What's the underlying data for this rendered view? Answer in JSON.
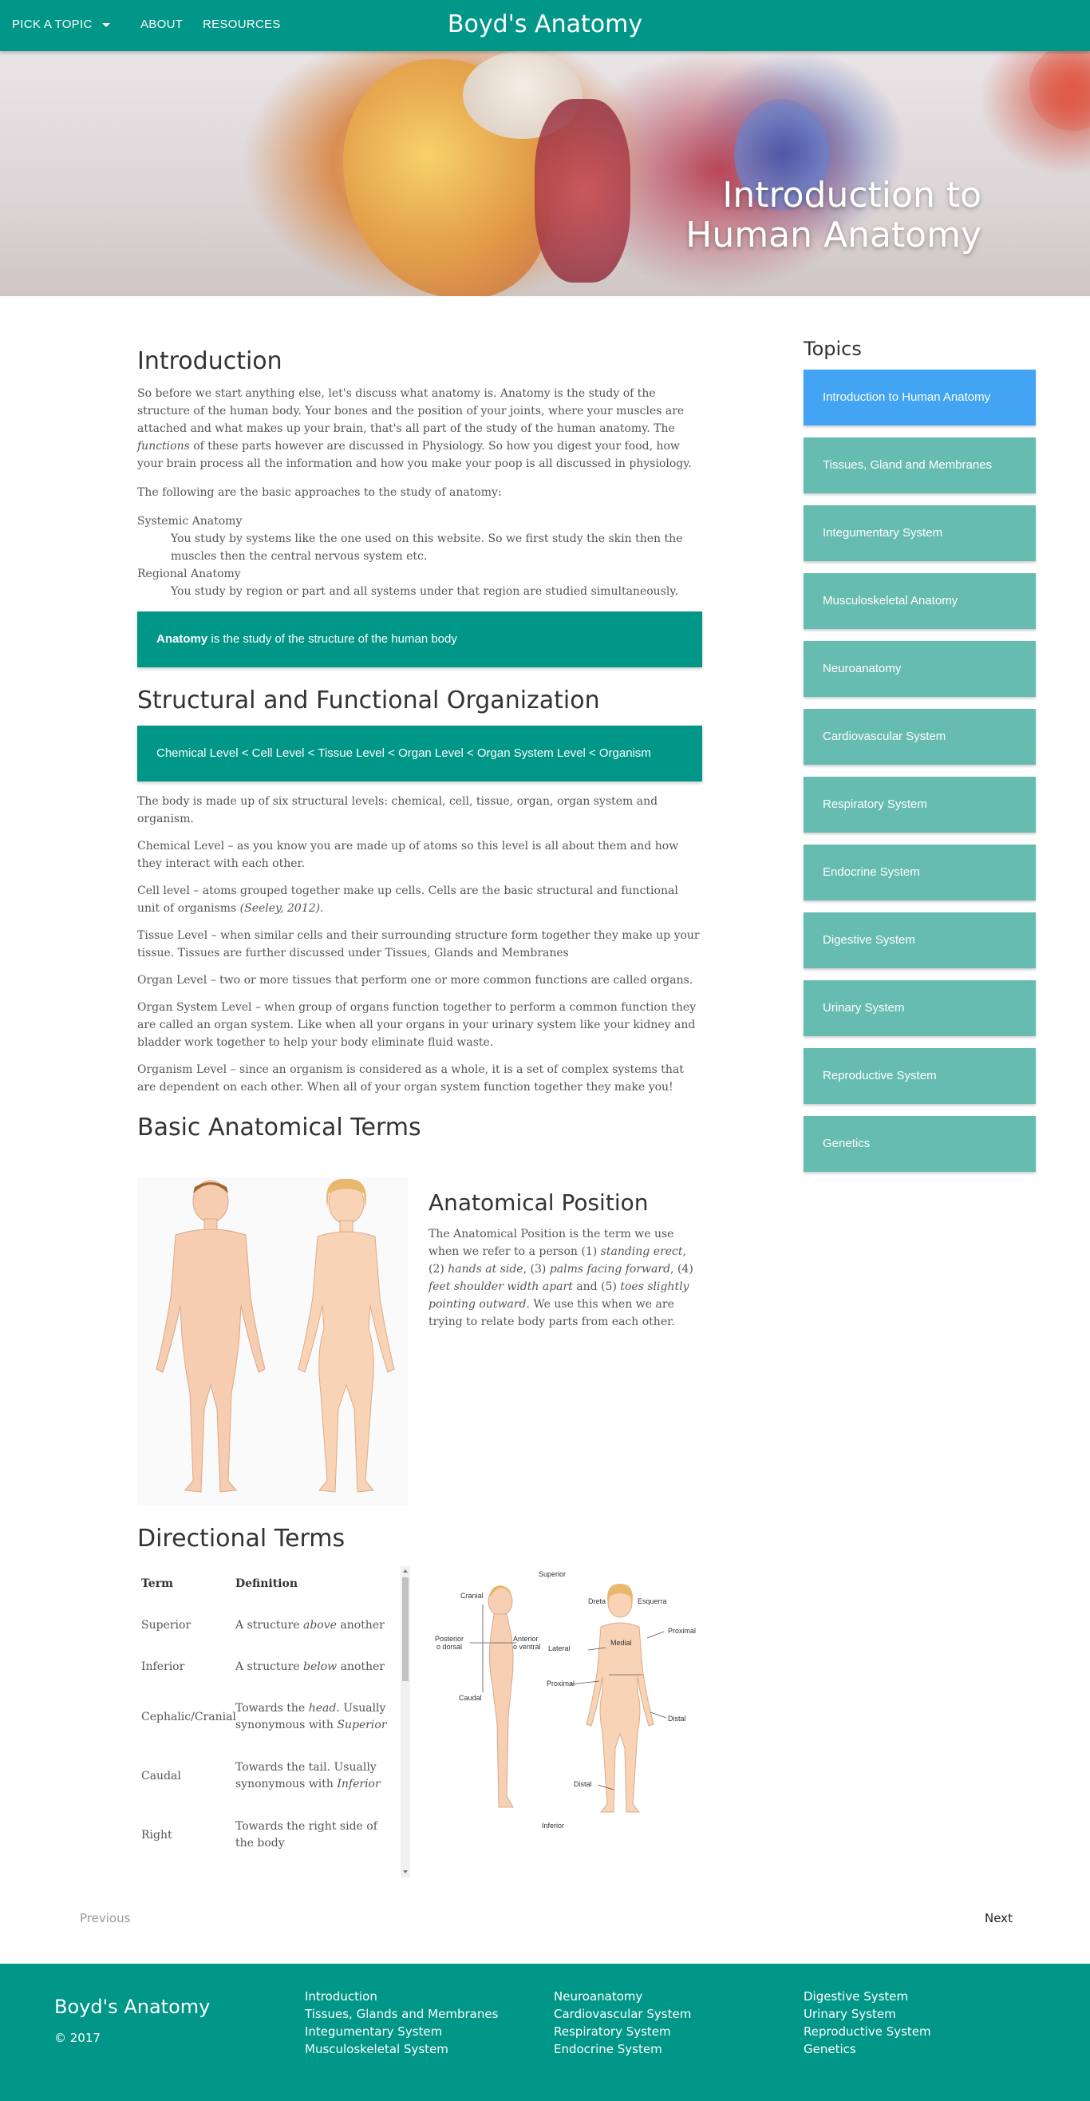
{
  "nav": {
    "pick_topic": "PICK A TOPIC",
    "about": "ABOUT",
    "resources": "RESOURCES",
    "brand": "Boyd's Anatomy"
  },
  "hero": {
    "title_line1": "Introduction to",
    "title_line2": "Human Anatomy"
  },
  "intro": {
    "heading": "Introduction",
    "p1_a": "So before we start anything else, let's discuss what anatomy is. Anatomy is the study of the structure of the human body. Your bones and the position of your joints, where your muscles are attached and what makes up your brain, that's all part of the study of the human anatomy. The ",
    "p1_em": "functions",
    "p1_b": " of these parts however are discussed in Physiology. So how you digest your food, how your brain process all the information and how you make your poop is all discussed in physiology.",
    "p2": "The following are the basic approaches to the study of anatomy:",
    "term1": "Systemic Anatomy",
    "def1": "You study by systems like the one used on this website. So we first study the skin then the muscles then the central nervous system etc.",
    "term2": "Regional Anatomy",
    "def2": "You study by region or part and all systems under that region are studied simultaneously.",
    "callout_strong": "Anatomy",
    "callout_rest": " is the study of the structure of the human body"
  },
  "structural": {
    "heading": "Structural and Functional Organization",
    "callout": "Chemical Level < Cell Level < Tissue Level < Organ Level < Organ System Level < Organism",
    "p1": "The body is made up of six structural levels: chemical, cell, tissue, organ, organ system and organism.",
    "p2": "Chemical Level – as you know you are made up of atoms so this level is all about them and how they interact with each other.",
    "p3_a": "Cell level – atoms grouped together make up cells. Cells are the basic structural and functional unit of organisms ",
    "p3_em": "(Seeley, 2012).",
    "p4": "Tissue Level – when similar cells and their surrounding structure form together they make up your tissue. Tissues are further discussed under Tissues, Glands and Membranes",
    "p5": "Organ Level – two or more tissues that perform one or more common functions are called organs.",
    "p6": "Organ System Level – when group of organs function together to perform a common function they are called an organ system. Like when all your organs in your urinary system like your kidney and bladder work together to help your body eliminate fluid waste.",
    "p7": "Organism Level – since an organism is considered as a whole, it is a set of complex systems that are dependent on each other. When all of your organ system function together they make you!"
  },
  "terms": {
    "heading": "Basic Anatomical Terms",
    "position_heading": "Anatomical Position",
    "pos_a": "The Anatomical Position is the term we use when we refer to a person (1) ",
    "pos_em1": "standing erect",
    "pos_b": ", (2) ",
    "pos_em2": "hands at side",
    "pos_c": ", (3) ",
    "pos_em3": "palms facing forward",
    "pos_d": ", (4) ",
    "pos_em4": "feet shoulder width apart",
    "pos_e": " and (5) ",
    "pos_em5": "toes slightly pointing outward",
    "pos_f": ". We use this when we are trying to relate body parts from each other."
  },
  "directional": {
    "heading": "Directional Terms",
    "col_term": "Term",
    "col_def": "Definition",
    "rows": [
      {
        "term": "Superior",
        "def_a": "A structure ",
        "def_em": "above",
        "def_b": " another"
      },
      {
        "term": "Inferior",
        "def_a": "A structure ",
        "def_em": "below",
        "def_b": " another"
      },
      {
        "term": "Cephalic/Cranial",
        "def_a": "Towards the ",
        "def_em": "head",
        "def_b": ". Usually synonymous with ",
        "def_em2": "Superior"
      },
      {
        "term": "Caudal",
        "def_a": "Towards the tail. Usually synonymous with ",
        "def_em": "Inferior",
        "def_b": ""
      },
      {
        "term": "Right",
        "def_a": "Towards the right side of the body",
        "def_em": "",
        "def_b": ""
      }
    ],
    "figure_labels": {
      "superior": "Superior",
      "cranial": "Cranial",
      "dreta": "Dreta",
      "esquerra": "Esquerra",
      "proximal_r": "Proximal",
      "posterior": "Posterior",
      "dorsal": "o dorsal",
      "anterior": "Anterior",
      "ventral": "o ventral",
      "medial": "Medial",
      "lateral": "Lateral",
      "proximal_l": "Proximal",
      "caudal": "Caudal",
      "distal_r": "Distal",
      "distal_l": "Distal",
      "inferior": "Inferior"
    }
  },
  "pager": {
    "previous": "Previous",
    "next": "Next"
  },
  "sidebar": {
    "heading": "Topics",
    "items": [
      "Introduction to Human Anatomy",
      "Tissues, Gland and Membranes",
      "Integumentary System",
      "Musculoskeletal Anatomy",
      "Neuroanatomy",
      "Cardiovascular System",
      "Respiratory System",
      "Endocrine System",
      "Digestive System",
      "Urinary System",
      "Reproductive System",
      "Genetics"
    ]
  },
  "footer": {
    "brand": "Boyd's Anatomy",
    "copyright": "© 2017",
    "col1": [
      "Introduction",
      "Tissues, Glands and Membranes",
      "Integumentary System",
      "Musculoskeletal System"
    ],
    "col2": [
      "Neuroanatomy",
      "Cardiovascular System",
      "Respiratory System",
      "Endocrine System"
    ],
    "col3": [
      "Digestive System",
      "Urinary System",
      "Reproductive System",
      "Genetics"
    ]
  },
  "colors": {
    "teal": "#009688",
    "teal_light": "#67bcb1",
    "active_blue": "#42a4f2"
  }
}
